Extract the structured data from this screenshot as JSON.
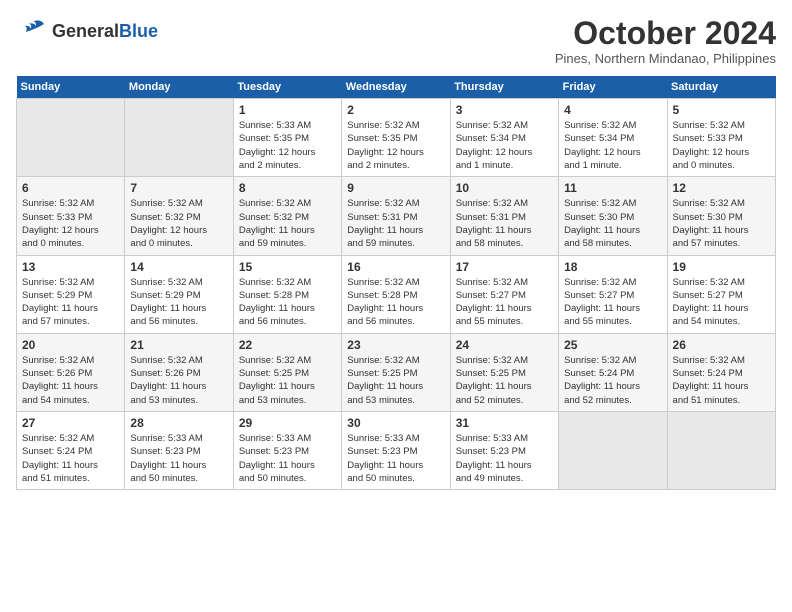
{
  "header": {
    "logo_general": "General",
    "logo_blue": "Blue",
    "month_year": "October 2024",
    "location": "Pines, Northern Mindanao, Philippines"
  },
  "weekdays": [
    "Sunday",
    "Monday",
    "Tuesday",
    "Wednesday",
    "Thursday",
    "Friday",
    "Saturday"
  ],
  "weeks": [
    [
      {
        "day": "",
        "info": ""
      },
      {
        "day": "",
        "info": ""
      },
      {
        "day": "1",
        "info": "Sunrise: 5:33 AM\nSunset: 5:35 PM\nDaylight: 12 hours\nand 2 minutes."
      },
      {
        "day": "2",
        "info": "Sunrise: 5:32 AM\nSunset: 5:35 PM\nDaylight: 12 hours\nand 2 minutes."
      },
      {
        "day": "3",
        "info": "Sunrise: 5:32 AM\nSunset: 5:34 PM\nDaylight: 12 hours\nand 1 minute."
      },
      {
        "day": "4",
        "info": "Sunrise: 5:32 AM\nSunset: 5:34 PM\nDaylight: 12 hours\nand 1 minute."
      },
      {
        "day": "5",
        "info": "Sunrise: 5:32 AM\nSunset: 5:33 PM\nDaylight: 12 hours\nand 0 minutes."
      }
    ],
    [
      {
        "day": "6",
        "info": "Sunrise: 5:32 AM\nSunset: 5:33 PM\nDaylight: 12 hours\nand 0 minutes."
      },
      {
        "day": "7",
        "info": "Sunrise: 5:32 AM\nSunset: 5:32 PM\nDaylight: 12 hours\nand 0 minutes."
      },
      {
        "day": "8",
        "info": "Sunrise: 5:32 AM\nSunset: 5:32 PM\nDaylight: 11 hours\nand 59 minutes."
      },
      {
        "day": "9",
        "info": "Sunrise: 5:32 AM\nSunset: 5:31 PM\nDaylight: 11 hours\nand 59 minutes."
      },
      {
        "day": "10",
        "info": "Sunrise: 5:32 AM\nSunset: 5:31 PM\nDaylight: 11 hours\nand 58 minutes."
      },
      {
        "day": "11",
        "info": "Sunrise: 5:32 AM\nSunset: 5:30 PM\nDaylight: 11 hours\nand 58 minutes."
      },
      {
        "day": "12",
        "info": "Sunrise: 5:32 AM\nSunset: 5:30 PM\nDaylight: 11 hours\nand 57 minutes."
      }
    ],
    [
      {
        "day": "13",
        "info": "Sunrise: 5:32 AM\nSunset: 5:29 PM\nDaylight: 11 hours\nand 57 minutes."
      },
      {
        "day": "14",
        "info": "Sunrise: 5:32 AM\nSunset: 5:29 PM\nDaylight: 11 hours\nand 56 minutes."
      },
      {
        "day": "15",
        "info": "Sunrise: 5:32 AM\nSunset: 5:28 PM\nDaylight: 11 hours\nand 56 minutes."
      },
      {
        "day": "16",
        "info": "Sunrise: 5:32 AM\nSunset: 5:28 PM\nDaylight: 11 hours\nand 56 minutes."
      },
      {
        "day": "17",
        "info": "Sunrise: 5:32 AM\nSunset: 5:27 PM\nDaylight: 11 hours\nand 55 minutes."
      },
      {
        "day": "18",
        "info": "Sunrise: 5:32 AM\nSunset: 5:27 PM\nDaylight: 11 hours\nand 55 minutes."
      },
      {
        "day": "19",
        "info": "Sunrise: 5:32 AM\nSunset: 5:27 PM\nDaylight: 11 hours\nand 54 minutes."
      }
    ],
    [
      {
        "day": "20",
        "info": "Sunrise: 5:32 AM\nSunset: 5:26 PM\nDaylight: 11 hours\nand 54 minutes."
      },
      {
        "day": "21",
        "info": "Sunrise: 5:32 AM\nSunset: 5:26 PM\nDaylight: 11 hours\nand 53 minutes."
      },
      {
        "day": "22",
        "info": "Sunrise: 5:32 AM\nSunset: 5:25 PM\nDaylight: 11 hours\nand 53 minutes."
      },
      {
        "day": "23",
        "info": "Sunrise: 5:32 AM\nSunset: 5:25 PM\nDaylight: 11 hours\nand 53 minutes."
      },
      {
        "day": "24",
        "info": "Sunrise: 5:32 AM\nSunset: 5:25 PM\nDaylight: 11 hours\nand 52 minutes."
      },
      {
        "day": "25",
        "info": "Sunrise: 5:32 AM\nSunset: 5:24 PM\nDaylight: 11 hours\nand 52 minutes."
      },
      {
        "day": "26",
        "info": "Sunrise: 5:32 AM\nSunset: 5:24 PM\nDaylight: 11 hours\nand 51 minutes."
      }
    ],
    [
      {
        "day": "27",
        "info": "Sunrise: 5:32 AM\nSunset: 5:24 PM\nDaylight: 11 hours\nand 51 minutes."
      },
      {
        "day": "28",
        "info": "Sunrise: 5:33 AM\nSunset: 5:23 PM\nDaylight: 11 hours\nand 50 minutes."
      },
      {
        "day": "29",
        "info": "Sunrise: 5:33 AM\nSunset: 5:23 PM\nDaylight: 11 hours\nand 50 minutes."
      },
      {
        "day": "30",
        "info": "Sunrise: 5:33 AM\nSunset: 5:23 PM\nDaylight: 11 hours\nand 50 minutes."
      },
      {
        "day": "31",
        "info": "Sunrise: 5:33 AM\nSunset: 5:23 PM\nDaylight: 11 hours\nand 49 minutes."
      },
      {
        "day": "",
        "info": ""
      },
      {
        "day": "",
        "info": ""
      }
    ]
  ]
}
